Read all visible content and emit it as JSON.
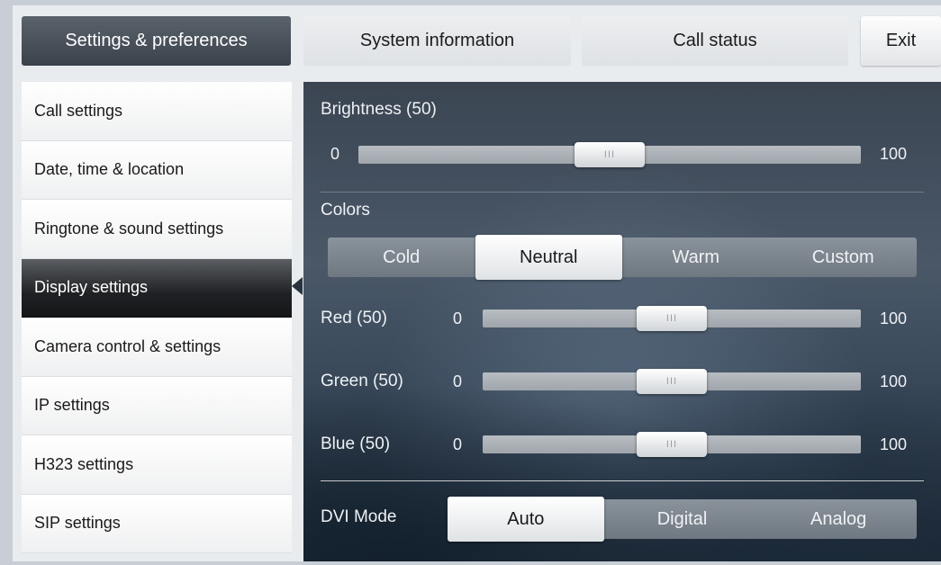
{
  "tabs": {
    "settings": "Settings & preferences",
    "system_info": "System information",
    "call_status": "Call status",
    "exit": "Exit"
  },
  "sidebar": {
    "items": [
      {
        "label": "Call settings"
      },
      {
        "label": "Date, time & location"
      },
      {
        "label": "Ringtone & sound settings"
      },
      {
        "label": "Display settings",
        "active": true
      },
      {
        "label": "Camera control & settings"
      },
      {
        "label": "IP settings"
      },
      {
        "label": "H323 settings"
      },
      {
        "label": "SIP settings"
      }
    ]
  },
  "display": {
    "brightness": {
      "label": "Brightness (50)",
      "min": "0",
      "max": "100",
      "value": 50
    },
    "colors": {
      "label": "Colors",
      "options": [
        "Cold",
        "Neutral",
        "Warm",
        "Custom"
      ],
      "selected": "Neutral"
    },
    "red": {
      "label": "Red (50)",
      "min": "0",
      "max": "100",
      "value": 50
    },
    "green": {
      "label": "Green (50)",
      "min": "0",
      "max": "100",
      "value": 50
    },
    "blue": {
      "label": "Blue (50)",
      "min": "0",
      "max": "100",
      "value": 50
    },
    "dvi": {
      "label": "DVI Mode",
      "options": [
        "Auto",
        "Digital",
        "Analog"
      ],
      "selected": "Auto"
    },
    "knob_grip": "III"
  }
}
